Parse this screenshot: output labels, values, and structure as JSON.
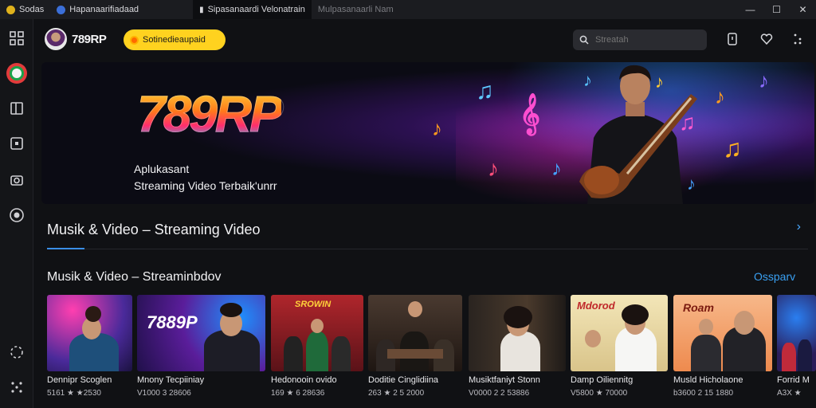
{
  "titlebar": {
    "tabs": [
      {
        "label": "Sodas",
        "color": "#e0b21c"
      },
      {
        "label": "Hapanaarifiadaad",
        "color": "#3b6fd9"
      },
      {
        "label": "Sipasanaardi Velonatrain"
      },
      {
        "label": "Mulpasanaarli Nam"
      }
    ],
    "controls": {
      "minimize": "—",
      "maximize": "☐",
      "close": "✕"
    }
  },
  "header": {
    "brand": "789RP",
    "pill_label": "Sotinedieaupaid",
    "search_placeholder": "Streatah"
  },
  "hero": {
    "logo": "789RP",
    "subtitle_line1": "Aplukasant",
    "subtitle_line2": "Streaming Video Terbaik'unrr"
  },
  "section": {
    "title": "Musik & Video – Streaming Video",
    "subtitle": "Musik & Video – Streaminbdov",
    "see_all": "Ossparv"
  },
  "cards": [
    {
      "title": "Dennipr Scoglen",
      "meta": "5161 ★ ★2530",
      "accent": "#ff2fa8",
      "bg": "#3a2a80"
    },
    {
      "title": "Mnony Tecpiiniay",
      "meta": "V1000 3 28606",
      "accent": "#1e90ff",
      "bg": "#5a1d9a",
      "overlay": "7889P"
    },
    {
      "title": "Hedonooin ovido",
      "meta": "169 ★ 6 28636",
      "accent": "#ffcf33",
      "bg": "#8a1c22",
      "overlay": "SROWIN"
    },
    {
      "title": "Doditie Cinglidiina",
      "meta": "263 ★ 2 5 2000",
      "accent": "#c9864a",
      "bg": "#3b2a1f"
    },
    {
      "title": "Musiktfaniyt Stonn",
      "meta": "V0000 2 2 53886",
      "accent": "#d6a26c",
      "bg": "#2c2722"
    },
    {
      "title": "Damp Oiliennitg",
      "meta": "V5800 ★ 70000",
      "accent": "#ffd84a",
      "bg": "#e6d9a8",
      "overlay": "Mdorod"
    },
    {
      "title": "Musld Hicholaone",
      "meta": "b3600 2 15 1880",
      "accent": "#f08a34",
      "bg": "#f2a87a",
      "overlay": "Roam"
    },
    {
      "title": "Forrid M",
      "meta": "A3X ★",
      "accent": "#2a7ef0",
      "bg": "#2b1d5a"
    }
  ]
}
